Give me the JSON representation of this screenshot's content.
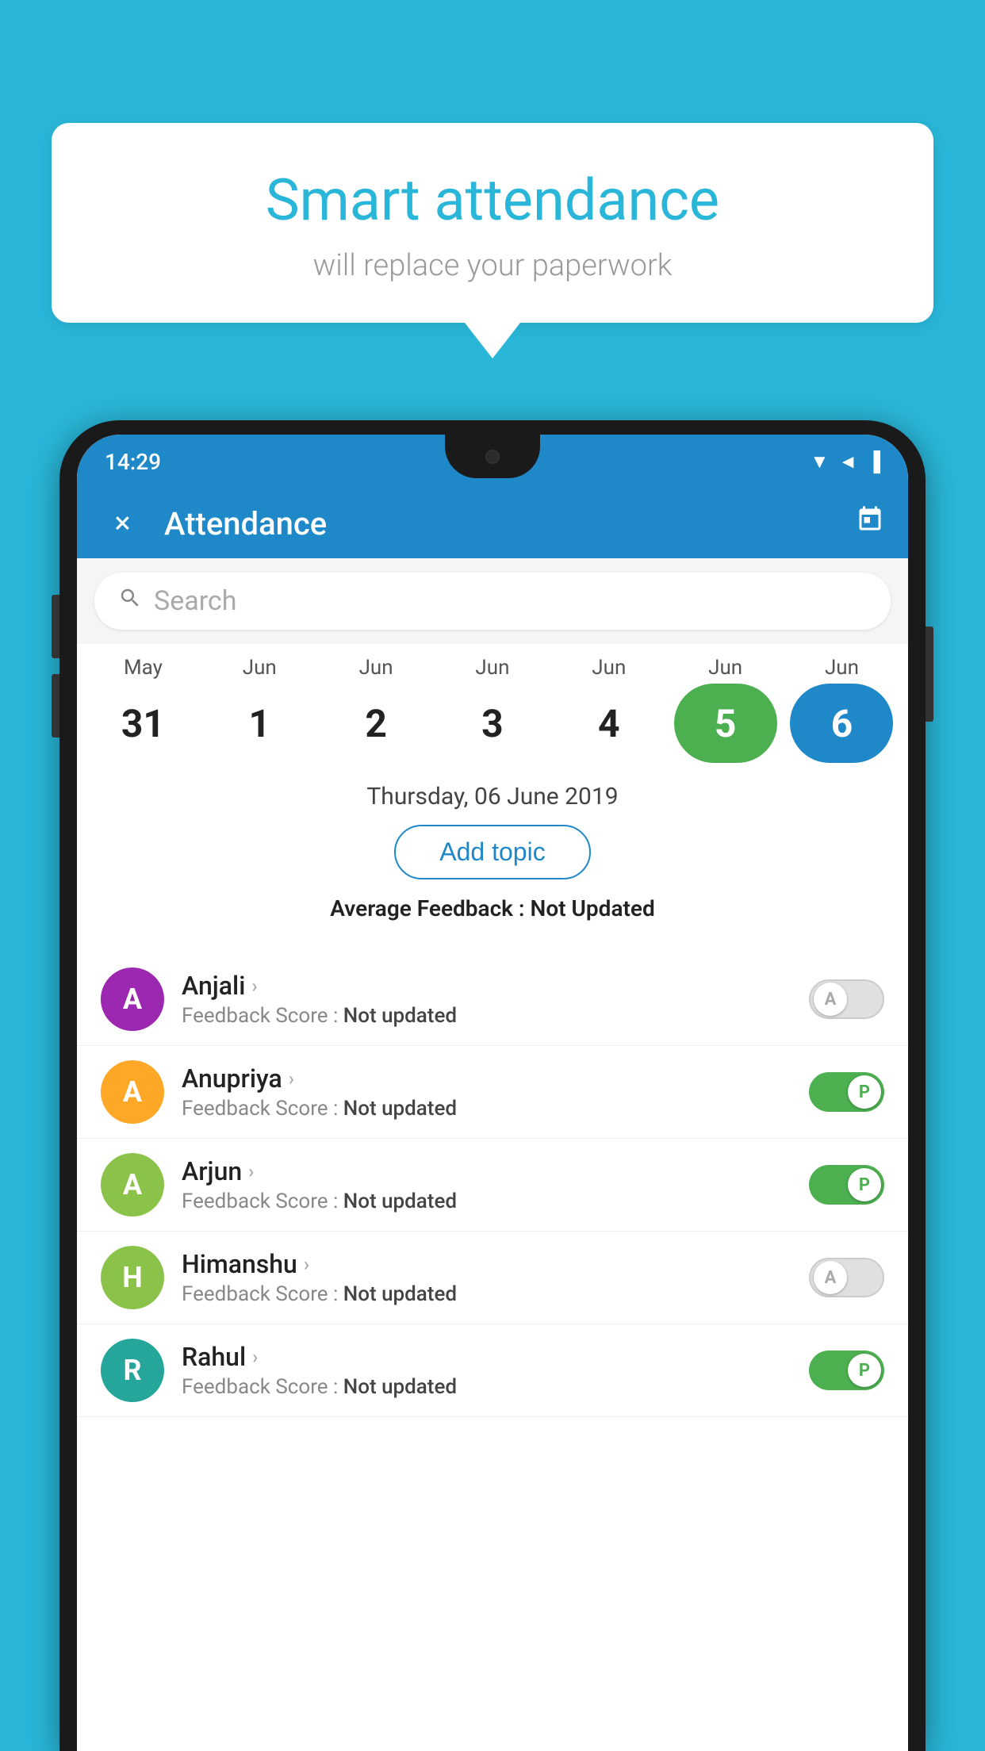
{
  "background_color": "#29b6d8",
  "speech_bubble": {
    "title": "Smart attendance",
    "subtitle": "will replace your paperwork"
  },
  "status_bar": {
    "time": "14:29",
    "signal_icons": "▼◄▐"
  },
  "app_bar": {
    "title": "Attendance",
    "close_label": "×",
    "calendar_icon": "📅"
  },
  "search": {
    "placeholder": "Search"
  },
  "calendar": {
    "months": [
      "May",
      "Jun",
      "Jun",
      "Jun",
      "Jun",
      "Jun",
      "Jun"
    ],
    "dates": [
      "31",
      "1",
      "2",
      "3",
      "4",
      "5",
      "6"
    ],
    "states": [
      "normal",
      "normal",
      "normal",
      "normal",
      "normal",
      "today",
      "selected"
    ]
  },
  "selected_date": {
    "label": "Thursday, 06 June 2019"
  },
  "add_topic_button": "Add topic",
  "average_feedback": {
    "label": "Average Feedback : ",
    "value": "Not Updated"
  },
  "students": [
    {
      "name": "Anjali",
      "avatar_letter": "A",
      "avatar_color": "#9c27b0",
      "feedback_label": "Feedback Score : ",
      "feedback_value": "Not updated",
      "toggle_state": "off",
      "toggle_letter": "A"
    },
    {
      "name": "Anupriya",
      "avatar_letter": "A",
      "avatar_color": "#ffa726",
      "feedback_label": "Feedback Score : ",
      "feedback_value": "Not updated",
      "toggle_state": "on",
      "toggle_letter": "P"
    },
    {
      "name": "Arjun",
      "avatar_letter": "A",
      "avatar_color": "#8bc34a",
      "feedback_label": "Feedback Score : ",
      "feedback_value": "Not updated",
      "toggle_state": "on",
      "toggle_letter": "P"
    },
    {
      "name": "Himanshu",
      "avatar_letter": "H",
      "avatar_color": "#8bc34a",
      "feedback_label": "Feedback Score : ",
      "feedback_value": "Not updated",
      "toggle_state": "off",
      "toggle_letter": "A"
    },
    {
      "name": "Rahul",
      "avatar_letter": "R",
      "avatar_color": "#26a69a",
      "feedback_label": "Feedback Score : ",
      "feedback_value": "Not updated",
      "toggle_state": "on",
      "toggle_letter": "P"
    }
  ]
}
